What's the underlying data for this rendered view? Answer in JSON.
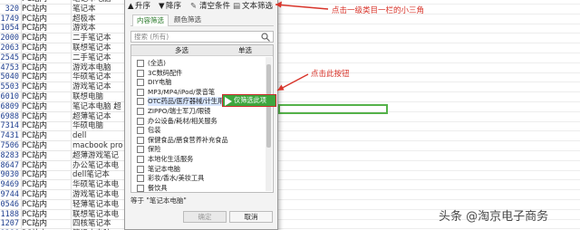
{
  "rows": [
    {
      "num": "",
      "a": "PC站内",
      "b": "笔记本电脑"
    },
    {
      "num": "320",
      "a": "PC站内",
      "b": "笔记本"
    },
    {
      "num": "1749",
      "a": "PC站内",
      "b": "超极本"
    },
    {
      "num": "1054",
      "a": "PC站内",
      "b": "游戏本"
    },
    {
      "num": "2000",
      "a": "PC站内",
      "b": "二手笔记本"
    },
    {
      "num": "2063",
      "a": "PC站内",
      "b": "联想笔记本"
    },
    {
      "num": "2545",
      "a": "PC站内",
      "b": "二手笔记本"
    },
    {
      "num": "4753",
      "a": "PC站内",
      "b": "游戏本电脑"
    },
    {
      "num": "5040",
      "a": "PC站内",
      "b": "华硕笔记本"
    },
    {
      "num": "5503",
      "a": "PC站内",
      "b": "游戏笔记本"
    },
    {
      "num": "6010",
      "a": "PC站内",
      "b": "联想电脑"
    },
    {
      "num": "6809",
      "a": "PC站内",
      "b": "笔记本电脑 超"
    },
    {
      "num": "6988",
      "a": "PC站内",
      "b": "超薄笔记本"
    },
    {
      "num": "7314",
      "a": "PC站内",
      "b": "华硕电脑"
    },
    {
      "num": "7431",
      "a": "PC站内",
      "b": "dell"
    },
    {
      "num": "7506",
      "a": "PC站内",
      "b": "macbook pro"
    },
    {
      "num": "8283",
      "a": "PC站内",
      "b": "超薄游戏笔记"
    },
    {
      "num": "8647",
      "a": "PC站内",
      "b": "办公笔记本电"
    },
    {
      "num": "9030",
      "a": "PC站内",
      "b": "dell笔记本"
    },
    {
      "num": "9469",
      "a": "PC站内",
      "b": "华硕笔记本电"
    },
    {
      "num": "9744",
      "a": "PC站内",
      "b": "游戏笔记本电"
    },
    {
      "num": "0546",
      "a": "PC站内",
      "b": "轻薄笔记本电"
    },
    {
      "num": "1188",
      "a": "PC站内",
      "b": "联想笔记本电"
    },
    {
      "num": "1207",
      "a": "PC站内",
      "b": "四核笔记本"
    },
    {
      "num": "1286",
      "a": "PC站内",
      "b": "笔记本电脑"
    }
  ],
  "panel": {
    "sort_asc": "升序",
    "sort_desc": "降序",
    "clear": "清空条件",
    "text_filter": "文本筛选",
    "tab_content": "内容筛选",
    "tab_color": "颜色筛选",
    "search_placeholder": "搜索 (所有)",
    "col_multi": "多选",
    "col_single": "单选",
    "items": [
      "(全选)",
      "3C数码配件",
      "DIY电脑",
      "MP3/MP4/iPod/录音笔",
      "OTC药品/医疗器械/计生用品",
      "ZIPPO/瑞士军刀/眼镜",
      "办公设备/耗材/相关服务",
      "包装",
      "保健食品/膳食营养补充食品",
      "保险",
      "本地化生活服务",
      "笔记本电脑",
      "彩妆/香水/美妆工具",
      "餐饮具"
    ],
    "footer": "等于 \"笔记本电脑\"",
    "ok": "确定",
    "cancel": "取消",
    "flyout": "仅筛选此项"
  },
  "annotations": {
    "top": "点击一级类目一栏的小三角",
    "mid": "点击此按钮"
  },
  "watermark": "头条 @淘京电子商务",
  "colors": {
    "accent_red": "#d8342a",
    "flyout_green": "#3ea63e",
    "highlight_green": "#55b24a"
  }
}
